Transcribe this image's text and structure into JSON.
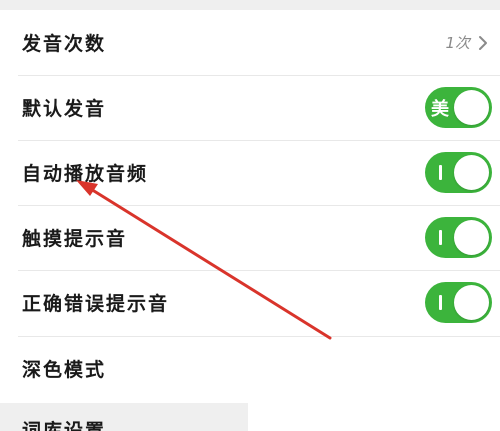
{
  "settings": {
    "items": [
      {
        "label": "发音次数",
        "value": "1次",
        "control": "chevron-link"
      },
      {
        "label": "默认发音",
        "control": "toggle",
        "on_text": "美",
        "state": "on"
      },
      {
        "label": "自动播放音频",
        "control": "toggle",
        "state": "on"
      },
      {
        "label": "触摸提示音",
        "control": "toggle",
        "state": "on"
      },
      {
        "label": "正确错误提示音",
        "control": "toggle",
        "state": "on"
      },
      {
        "label": "深色模式",
        "control": "none"
      }
    ],
    "partial_section_label": "词库设置"
  },
  "colors": {
    "toggle_on": "#3cb43c",
    "annotation_arrow": "#d9342b",
    "value_text": "#8a8a8a"
  }
}
